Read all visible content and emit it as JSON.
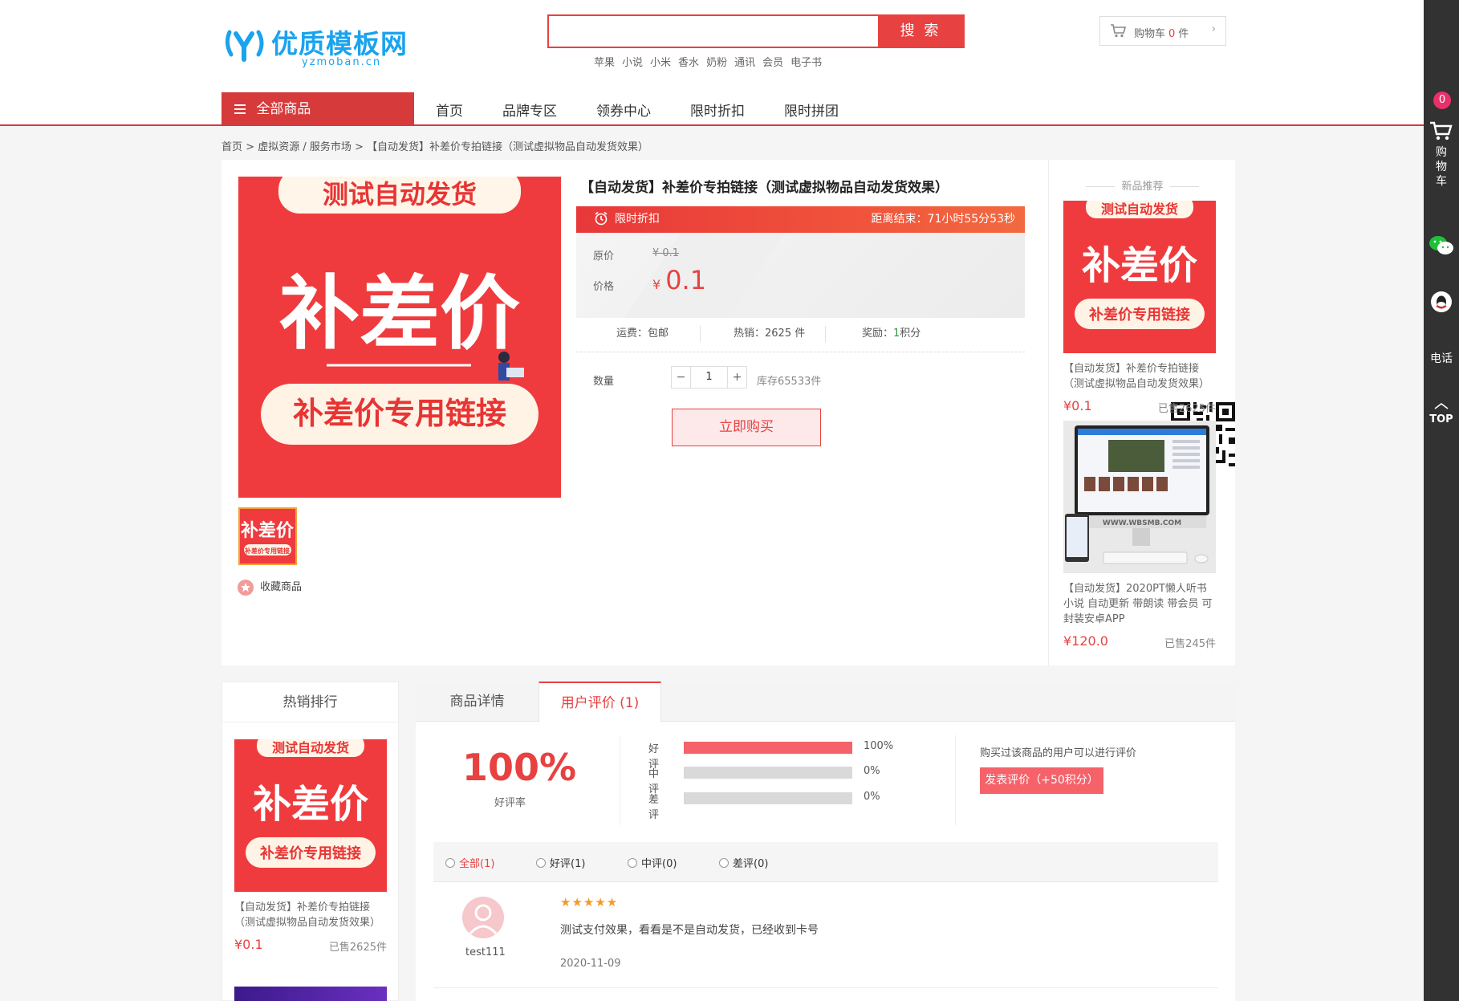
{
  "header": {
    "logo_name": "优质模板网",
    "logo_domain": "yzmoban.cn",
    "search_placeholder": "",
    "search_button": "搜 索",
    "hotwords": [
      "苹果",
      "小说",
      "小米",
      "香水",
      "奶粉",
      "通讯",
      "会员",
      "电子书"
    ],
    "cart_label": "购物车",
    "cart_count": "0",
    "cart_unit": "件"
  },
  "nav": {
    "all_categories": "全部商品",
    "items": [
      "首页",
      "品牌专区",
      "领券中心",
      "限时折扣",
      "限时拼团"
    ]
  },
  "sidebar": {
    "cart_badge": "0",
    "cart_label_chars": [
      "购",
      "物",
      "车"
    ],
    "phone": "电话",
    "top": "TOP"
  },
  "breadcrumb": {
    "home": "首页",
    "category": "虚拟资源 / 服务市场",
    "current": "【自动发货】补差价专拍链接（测试虚拟物品自动发货效果）",
    "sep": ">"
  },
  "product": {
    "title": "【自动发货】补差价专拍链接（测试虚拟物品自动发货效果）",
    "image_top_text": "测试自动发货",
    "image_main_text": "补差价",
    "image_bottom_text": "补差价专用链接",
    "thumb_main_text": "补差价",
    "thumb_sub_text": "补差价专用链接",
    "flash_label": "限时折扣",
    "countdown": "距离结束：71小时55分53秒",
    "original_label": "原价",
    "original_price": "¥ 0.1",
    "price_label": "价格",
    "currency": "¥",
    "price": "0.1",
    "shipping": "运费：包邮",
    "sales": "热销：2625 件",
    "reward_label": "奖励：",
    "reward_value": "1",
    "reward_unit": "积分",
    "quantity_label": "数量",
    "quantity": "1",
    "stock": "库存65533件",
    "buy_button": "立即购买",
    "favorite": "收藏商品"
  },
  "new_recommend": {
    "heading": "新品推荐",
    "items": [
      {
        "name": "【自动发货】补差价专拍链接（测试虚拟物品自动发货效果）",
        "price": "¥0.1",
        "sold": "已售2625件"
      },
      {
        "name": "【自动发货】2020PT懒人听书小说 自动更新 带朗读 带会员 可封装安卓APP",
        "price": "¥120.0",
        "sold": "已售245件",
        "screen_text": "WWW.WBSMB.COM"
      }
    ]
  },
  "hot_rank": {
    "heading": "热销排行",
    "items": [
      {
        "name": "【自动发货】补差价专拍链接（测试虚拟物品自动发货效果）",
        "price": "¥0.1",
        "sold": "已售2625件"
      }
    ]
  },
  "tabs": {
    "items": [
      "商品详情",
      "用户评价 (1)"
    ],
    "active": 1
  },
  "reviews": {
    "positive_rate": "100%",
    "positive_rate_label": "好评率",
    "breakdown": [
      {
        "label": "好评",
        "percent": 100,
        "text": "100%"
      },
      {
        "label": "中评",
        "percent": 0,
        "text": "0%"
      },
      {
        "label": "差评",
        "percent": 0,
        "text": "0%"
      }
    ],
    "can_review_text": "购买过该商品的用户可以进行评价",
    "post_button": "发表评价（+50积分）",
    "filters": [
      "全部(1)",
      "好评(1)",
      "中评(0)",
      "差评(0)"
    ],
    "list": [
      {
        "user": "test111",
        "stars": "★★★★★",
        "text": "测试支付效果，看看是不是自动发货，已经收到卡号",
        "date": "2020-11-09"
      }
    ]
  },
  "colors": {
    "brand_red": "#e84141",
    "logo_blue": "#1aa3ee",
    "sidebar_dark": "#323232"
  }
}
